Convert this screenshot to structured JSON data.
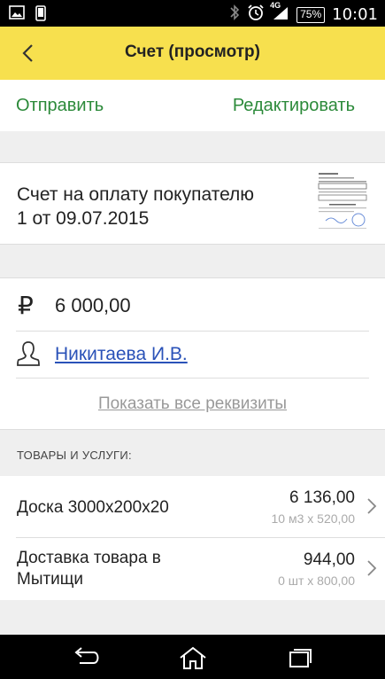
{
  "status_bar": {
    "time": "10:01",
    "battery": "75%",
    "network": "4G",
    "icons": [
      "image-icon",
      "phone-icon",
      "bluetooth-icon",
      "alarm-icon",
      "signal-icon",
      "battery-icon"
    ]
  },
  "header": {
    "title": "Счет (просмотр)",
    "back_icon": "chevron-left-icon",
    "background": "#f7e04e"
  },
  "actions": {
    "send_label": "Отправить",
    "edit_label": "Редактировать",
    "accent": "#2c8a3a"
  },
  "invoice": {
    "line1": "Счет на оплату покупателю",
    "line2": "1 от 09.07.2015",
    "thumbnail_icon": "document-thumbnail"
  },
  "amount": {
    "currency_symbol": "₽",
    "value": "6 000,00"
  },
  "contact": {
    "name": "Никитаева И.В.",
    "icon": "person-icon",
    "link_color": "#2a52b8"
  },
  "show_all_label": "Показать все реквизиты",
  "section_title": "ТОВАРЫ И УСЛУГИ:",
  "items": [
    {
      "name_line1": "Доска 3000х200х20",
      "name_line2": "",
      "sum": "6 136,00",
      "calc": "10 м3 х 520,00"
    },
    {
      "name_line1": "Доставка товара в",
      "name_line2": "Мытищи",
      "sum": "944,00",
      "calc": "0 шт х 800,00"
    }
  ],
  "nav_bar": {
    "icons": [
      "back-nav-icon",
      "home-nav-icon",
      "recents-nav-icon"
    ]
  }
}
